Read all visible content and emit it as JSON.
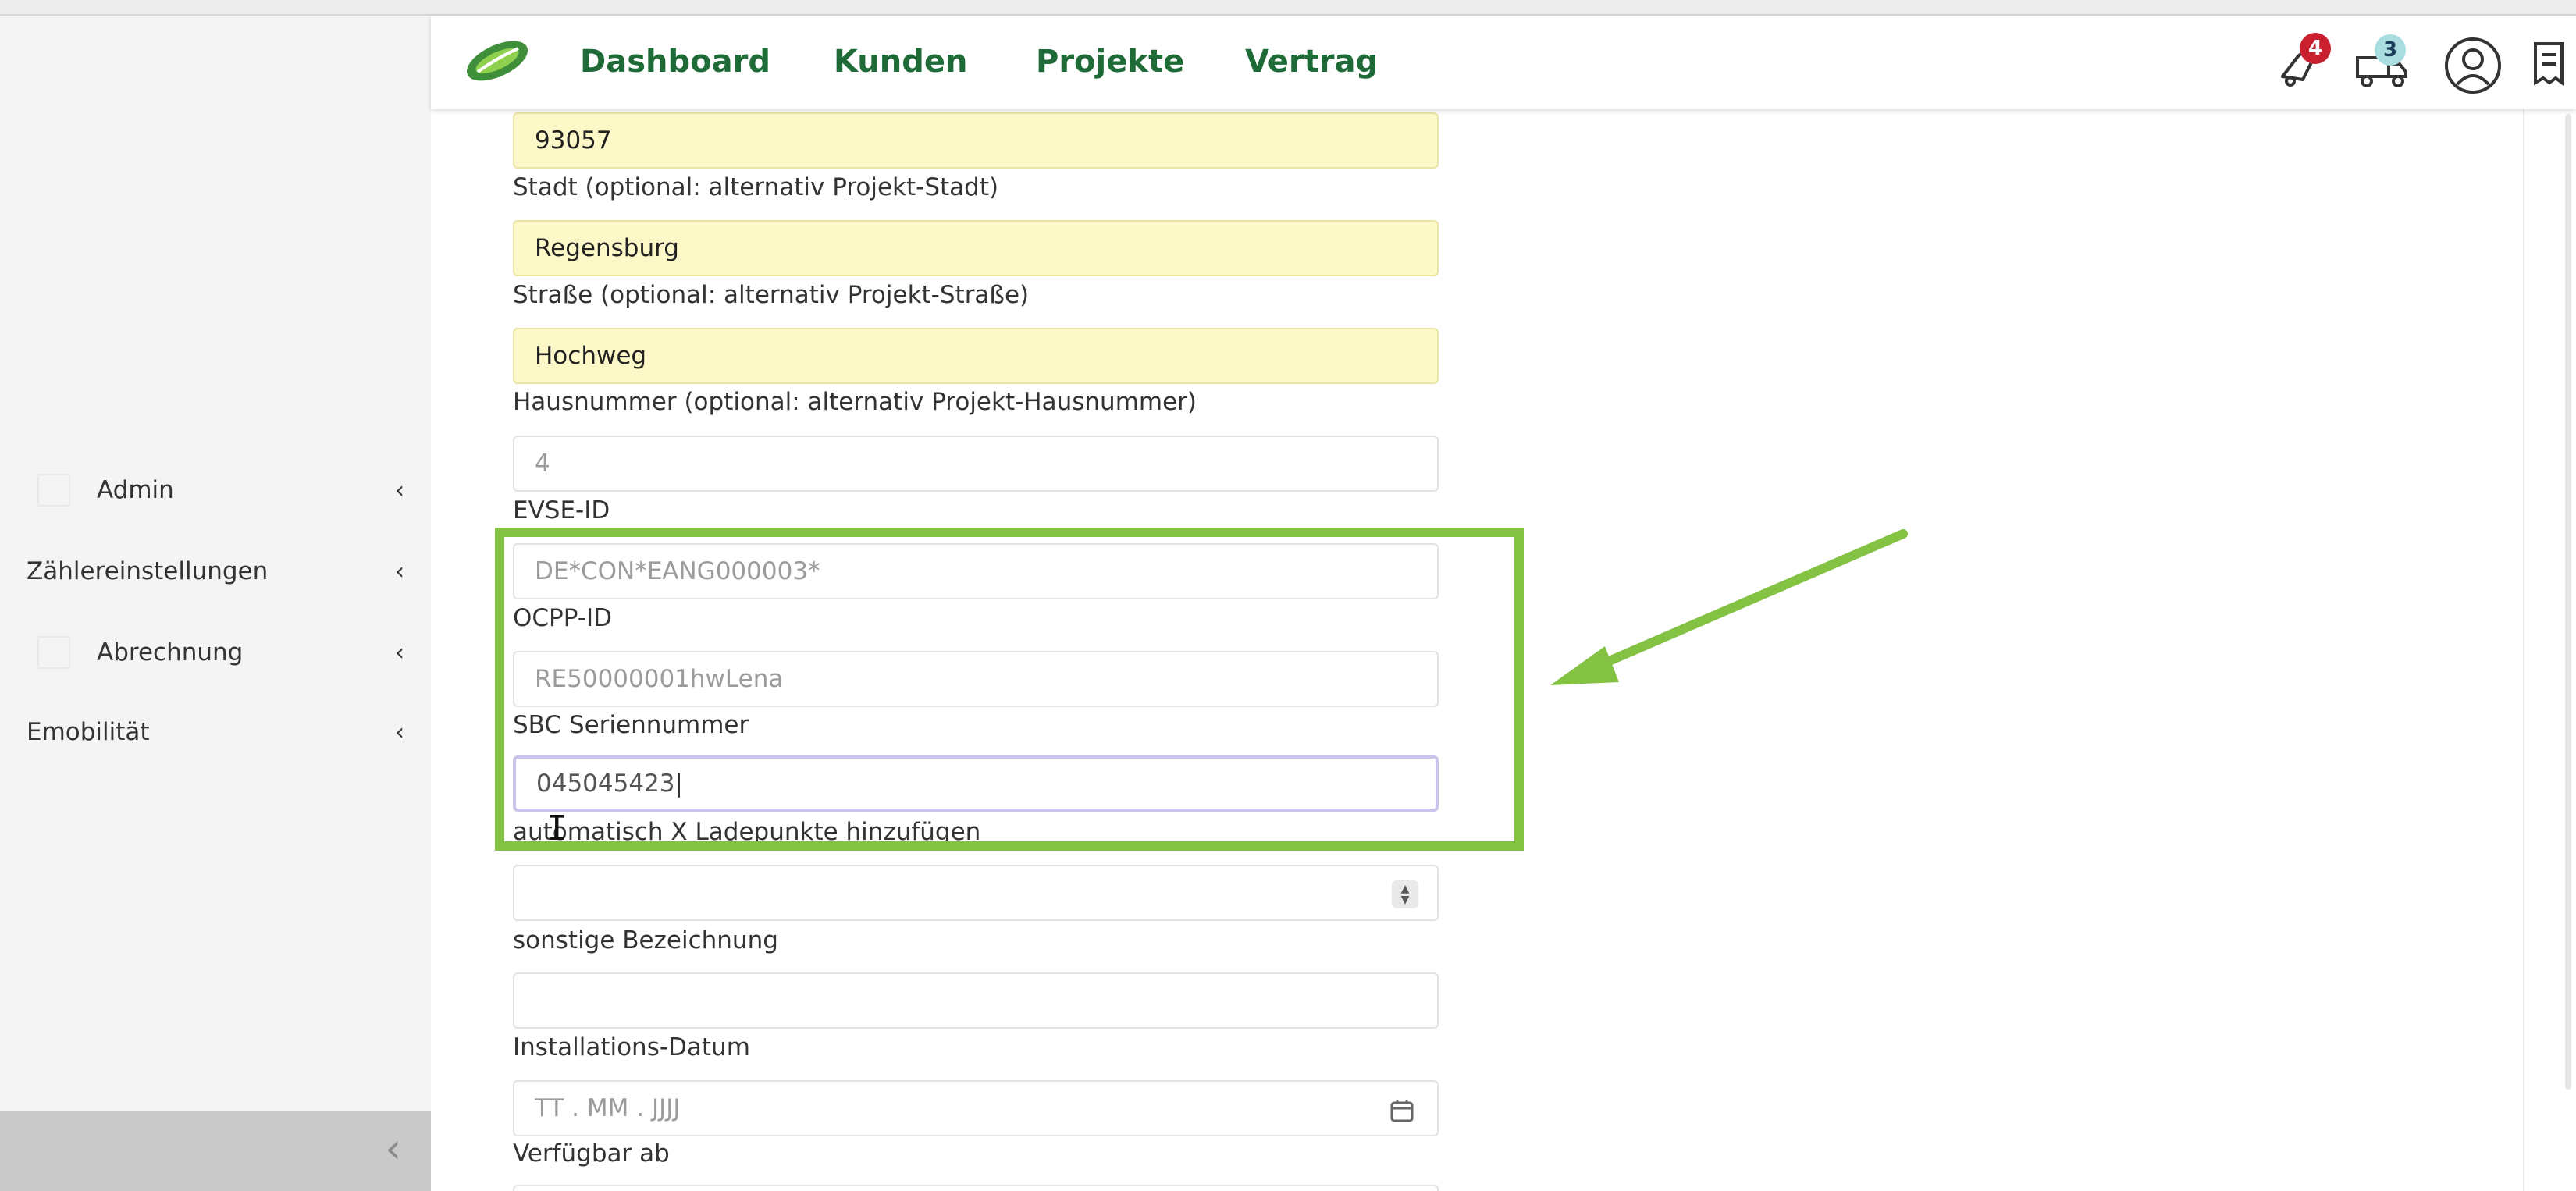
{
  "nav": {
    "links": [
      "Dashboard",
      "Kunden",
      "Projekte",
      "Vertrag"
    ],
    "notification_badge": "4",
    "messages_badge": "3",
    "icons": [
      "bell-icon",
      "truck-icon",
      "user-icon",
      "document-icon"
    ],
    "brand_color": "#1e6b37"
  },
  "sidebar": {
    "items": [
      {
        "label": "Admin",
        "icon": "square-icon"
      },
      {
        "label": "Zählereinstellungen"
      },
      {
        "label": "Abrechnung",
        "icon": "square-icon"
      },
      {
        "label": "Emobilität"
      }
    ],
    "collapse_icon": "chevron-left-icon"
  },
  "form": {
    "postcode_value": "93057",
    "city_label": "Stadt (optional: alternativ Projekt-Stadt)",
    "city_value": "Regensburg",
    "street_label": "Straße (optional: alternativ Projekt-Straße)",
    "street_value": "Hochweg",
    "house_label": "Hausnummer (optional: alternativ Projekt-Hausnummer)",
    "house_placeholder": "4",
    "evse_label": "EVSE-ID",
    "evse_placeholder": "DE*CON*EANG000003*",
    "ocpp_label": "OCPP-ID",
    "ocpp_placeholder": "RE50000001hwLena",
    "sbc_label": "SBC Seriennummer",
    "sbc_value": "045045423",
    "auto_label": "automatisch X Ladepunkte hinzufügen",
    "other_label": "sonstige Bezeichnung",
    "install_label": "Installations-Datum",
    "install_placeholder": "TT . MM . JJJJ",
    "available_label": "Verfügbar ab"
  },
  "annotation": {
    "highlight_color": "#83c242"
  }
}
